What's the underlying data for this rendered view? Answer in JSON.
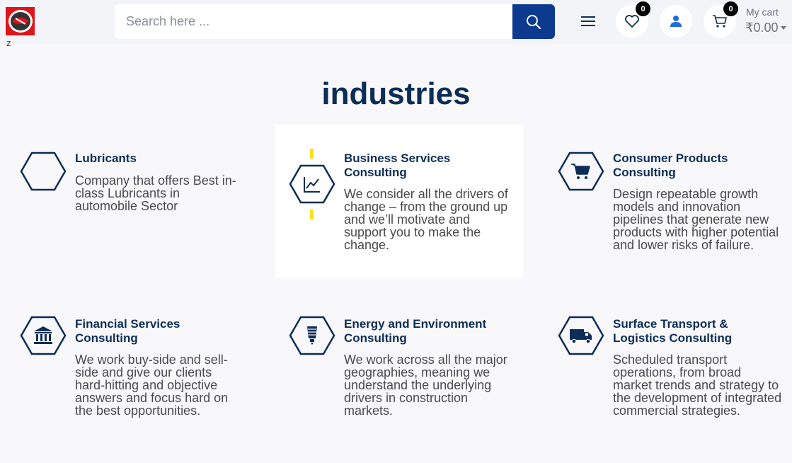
{
  "header": {
    "search_placeholder": "Search here ...",
    "wishlist_count": "0",
    "cart_count": "0",
    "cart_label": "My cart",
    "cart_total": "₹0.00"
  },
  "stray_text": "z",
  "section": {
    "title": "industries",
    "cards": [
      {
        "title": "Lubricants",
        "desc": "Company that offers Best in-class Lubricants in automobile Sector",
        "icon": "hexagon-icon"
      },
      {
        "title": "Business Services Consulting",
        "desc": "We consider all the drivers of change – from the ground up and we’ll motivate and support you to make the change.",
        "icon": "chart-icon"
      },
      {
        "title": "Consumer Products Consulting",
        "desc": "Design repeatable growth models and innovation pipelines that generate new products with higher potential and lower risks of failure.",
        "icon": "cart-icon"
      },
      {
        "title": "Financial Services Consulting",
        "desc": "We work buy-side and sell-side and give our clients hard-hitting and objective answers and focus hard on the best opportunities.",
        "icon": "bank-icon"
      },
      {
        "title": "Energy and Environment Consulting",
        "desc": "We work across all the major geographies, meaning we understand the underlying drivers in construction markets.",
        "icon": "bulb-icon"
      },
      {
        "title": "Surface Transport & Logistics Consulting",
        "desc": "Scheduled transport operations, from broad market trends and strategy to the development of integrated commercial strategies.",
        "icon": "truck-icon"
      }
    ]
  },
  "colors": {
    "navy": "#0c2d57",
    "search_button": "#0b3a8f",
    "logo_red": "#e0141b",
    "accent_yellow": "#f7e11a"
  }
}
